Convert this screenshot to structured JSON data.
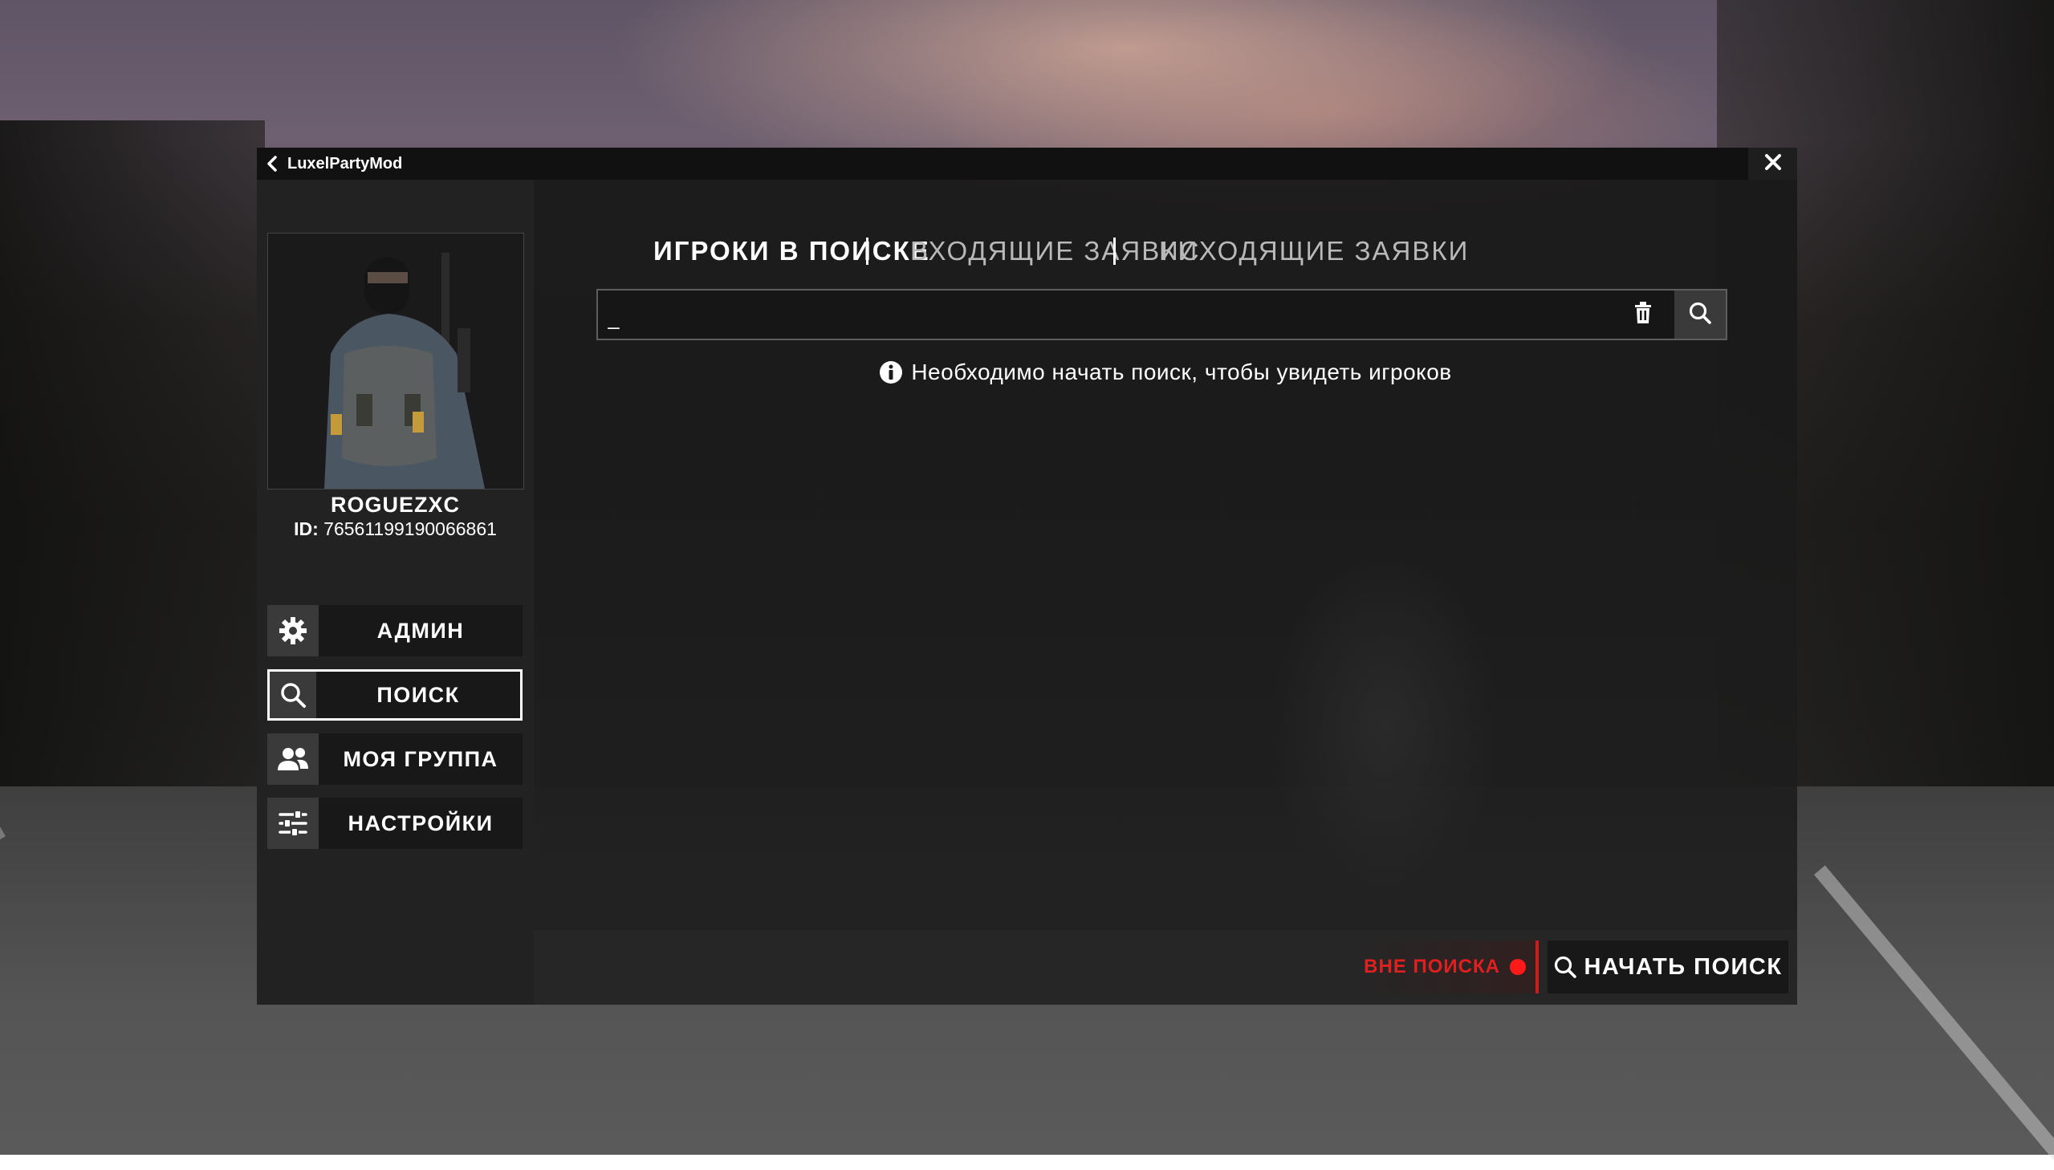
{
  "window": {
    "title": "LuxelPartyMod"
  },
  "profile": {
    "username": "ROGUEZXC",
    "id_label": "ID:",
    "id_value": "76561199190066861"
  },
  "nav": {
    "items": [
      {
        "label": "АДМИН",
        "icon": "gear-icon",
        "active": false
      },
      {
        "label": "ПОИСК",
        "icon": "search-icon",
        "active": true
      },
      {
        "label": "МОЯ ГРУППА",
        "icon": "users-icon",
        "active": false
      },
      {
        "label": "НАСТРОЙКИ",
        "icon": "sliders-icon",
        "active": false
      }
    ]
  },
  "tabs": [
    {
      "label": "ИГРОКИ В ПОИСКЕ",
      "active": true
    },
    {
      "label": "ВХОДЯЩИЕ ЗАЯВКИ",
      "active": false
    },
    {
      "label": "ИСХОДЯЩИЕ ЗАЯВКИ",
      "active": false
    }
  ],
  "search": {
    "value": "_",
    "placeholder": ""
  },
  "info": {
    "message": "Необходимо начать поиск, чтобы увидеть игроков"
  },
  "footer": {
    "status_text": "ВНЕ ПОИСКА",
    "status_color": "#e02020",
    "start_label": "НАЧАТЬ ПОИСК"
  }
}
